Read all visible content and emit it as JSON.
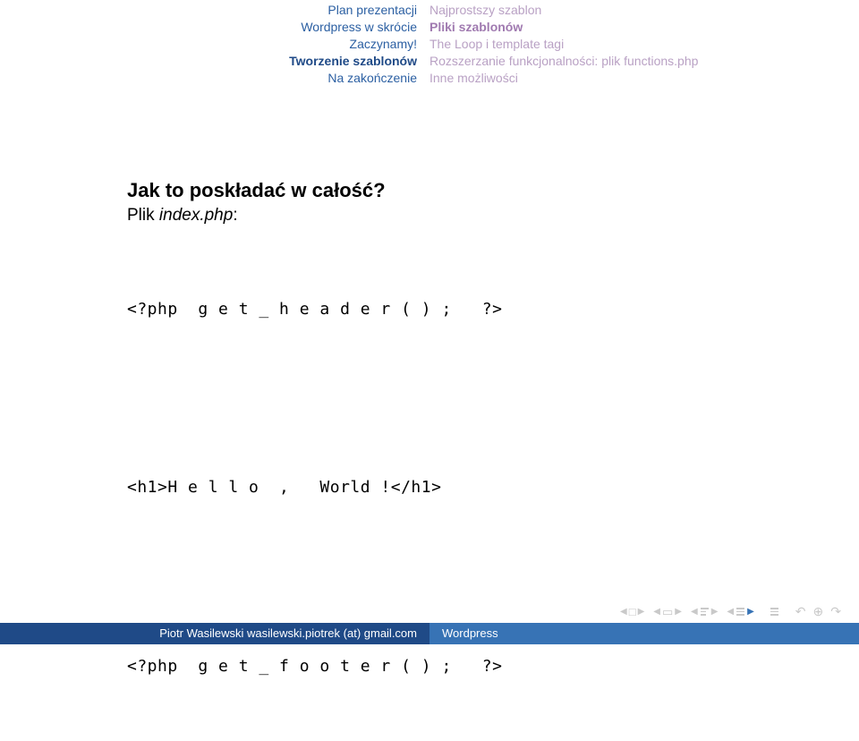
{
  "header": {
    "left": [
      "Plan prezentacji",
      "Wordpress w skrócie",
      "Zaczynamy!",
      "Tworzenie szablonów",
      "Na zakończenie"
    ],
    "left_bold_index": 3,
    "right": [
      "Najprostszy szablon",
      "Pliki szablonów",
      "The Loop i template tagi",
      "Rozszerzanie funkcjonalności: plik functions.php",
      "Inne możliwości"
    ],
    "right_bold_index": 1
  },
  "content": {
    "question": "Jak to poskładać w całość?",
    "filename_prefix": "Plik ",
    "filename_italic": "index.php",
    "filename_suffix": ":",
    "code_line1": "<?php  g e t _ h e a d e r ( ) ;   ?>",
    "code_line2": "<h1>H e l l o  ,   World !</h1>",
    "code_line3": "<?php  g e t _ f o o t e r ( ) ;   ?>"
  },
  "footer": {
    "author": "Piotr Wasilewski wasilewski.piotrek (at) gmail.com",
    "title": "Wordpress"
  }
}
